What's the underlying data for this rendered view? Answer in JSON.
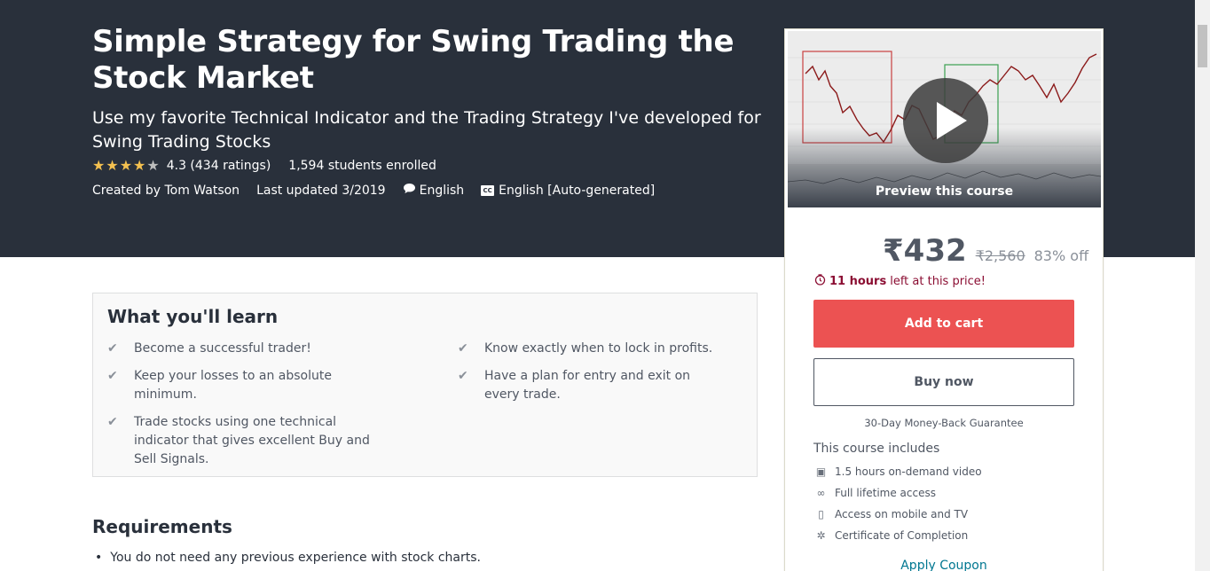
{
  "course": {
    "title": "Simple Strategy for Swing Trading the Stock Market",
    "subtitle": "Use my favorite Technical Indicator and the Trading Strategy I've developed for Swing Trading Stocks",
    "rating": 4.3,
    "rating_text": "4.3 (434 ratings)",
    "enrolled": "1,594 students enrolled",
    "created_by_label": "Created by",
    "author": "Tom Watson",
    "last_updated": "Last updated 3/2019",
    "language": "English",
    "captions": "English [Auto-generated]",
    "captions_badge": "CC"
  },
  "sidebar": {
    "preview_label": "Preview this course",
    "price": "₹432",
    "original_price": "₹2,560",
    "discount": "83% off",
    "timer_bold": "11 hours",
    "timer_rest": "left at this price!",
    "add_to_cart": "Add to cart",
    "buy_now": "Buy now",
    "guarantee": "30-Day Money-Back Guarantee",
    "includes_title": "This course includes",
    "includes": [
      {
        "icon": "video-icon",
        "glyph": "▣",
        "text": "1.5 hours on-demand video"
      },
      {
        "icon": "infinity-icon",
        "glyph": "∞",
        "text": "Full lifetime access"
      },
      {
        "icon": "mobile-icon",
        "glyph": "▯",
        "text": "Access on mobile and TV"
      },
      {
        "icon": "certificate-icon",
        "glyph": "✲",
        "text": "Certificate of Completion"
      }
    ],
    "coupon": "Apply Coupon"
  },
  "learn": {
    "title": "What you'll learn",
    "items": [
      "Become a successful trader!",
      "Know exactly when to lock in profits.",
      "Keep your losses to an absolute minimum.",
      "Have a plan for entry and exit on every trade.",
      "Trade stocks using one technical indicator that gives excellent Buy and Sell Signals."
    ]
  },
  "requirements": {
    "title": "Requirements",
    "items": [
      "You do not need any previous experience with stock charts."
    ]
  },
  "colors": {
    "hero_bg": "#29303b",
    "accent_red": "#ec5252",
    "star": "#f4c150",
    "timer": "#8b0e33",
    "link": "#007791"
  }
}
